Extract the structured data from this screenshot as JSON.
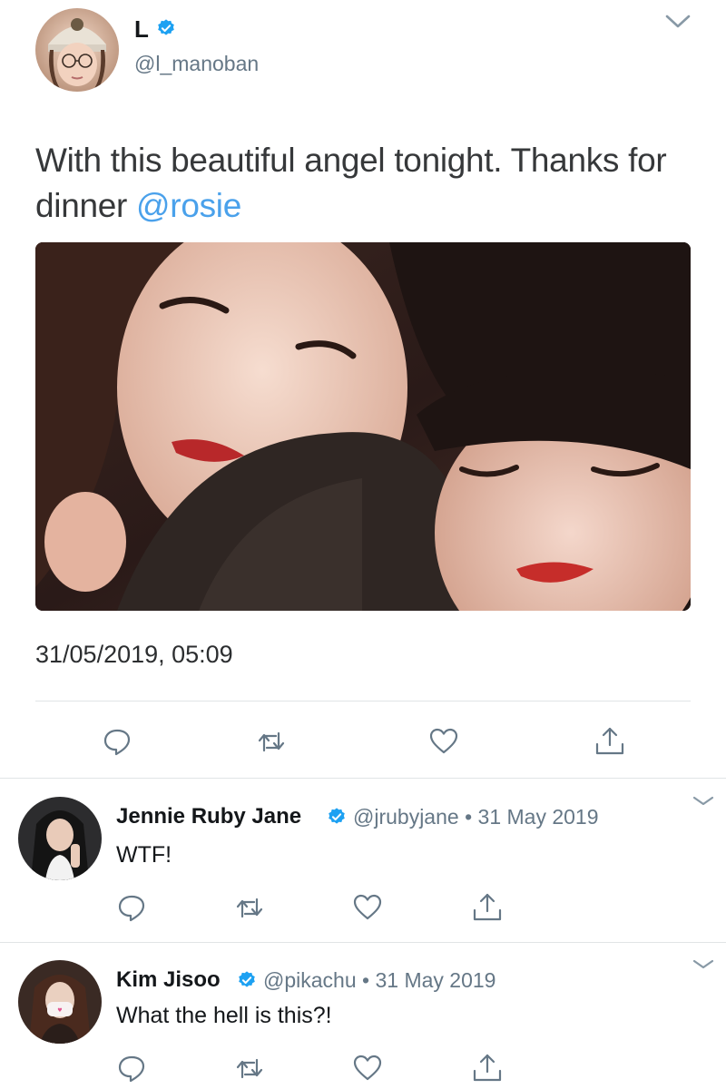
{
  "main_tweet": {
    "name": "L",
    "handle": "@l_manoban",
    "text_before": "With this beautiful angel tonight. Thanks for dinner ",
    "mention": "@rosie",
    "timestamp": "31/05/2019, 05:09",
    "avatar_icon": "avatar-photo",
    "photo_icon": "photo-two-women"
  },
  "replies": [
    {
      "name": "Jennie Ruby Jane",
      "handle": "@jrubyjane",
      "separator": "•",
      "date": "31 May 2019",
      "text": "WTF!"
    },
    {
      "name": "Kim Jisoo",
      "handle": "@pikachu",
      "separator": "•",
      "date": "31 May 2019",
      "text": "What the hell is this?!"
    }
  ],
  "colors": {
    "verified_blue": "#1da1f2",
    "mention_blue": "#4aa1eb",
    "icon_gray": "#657786",
    "divider": "#e1e4e6"
  },
  "icons": [
    "chevron-down-icon",
    "verified-badge-icon",
    "reply-icon",
    "retweet-icon",
    "like-icon",
    "share-icon"
  ]
}
